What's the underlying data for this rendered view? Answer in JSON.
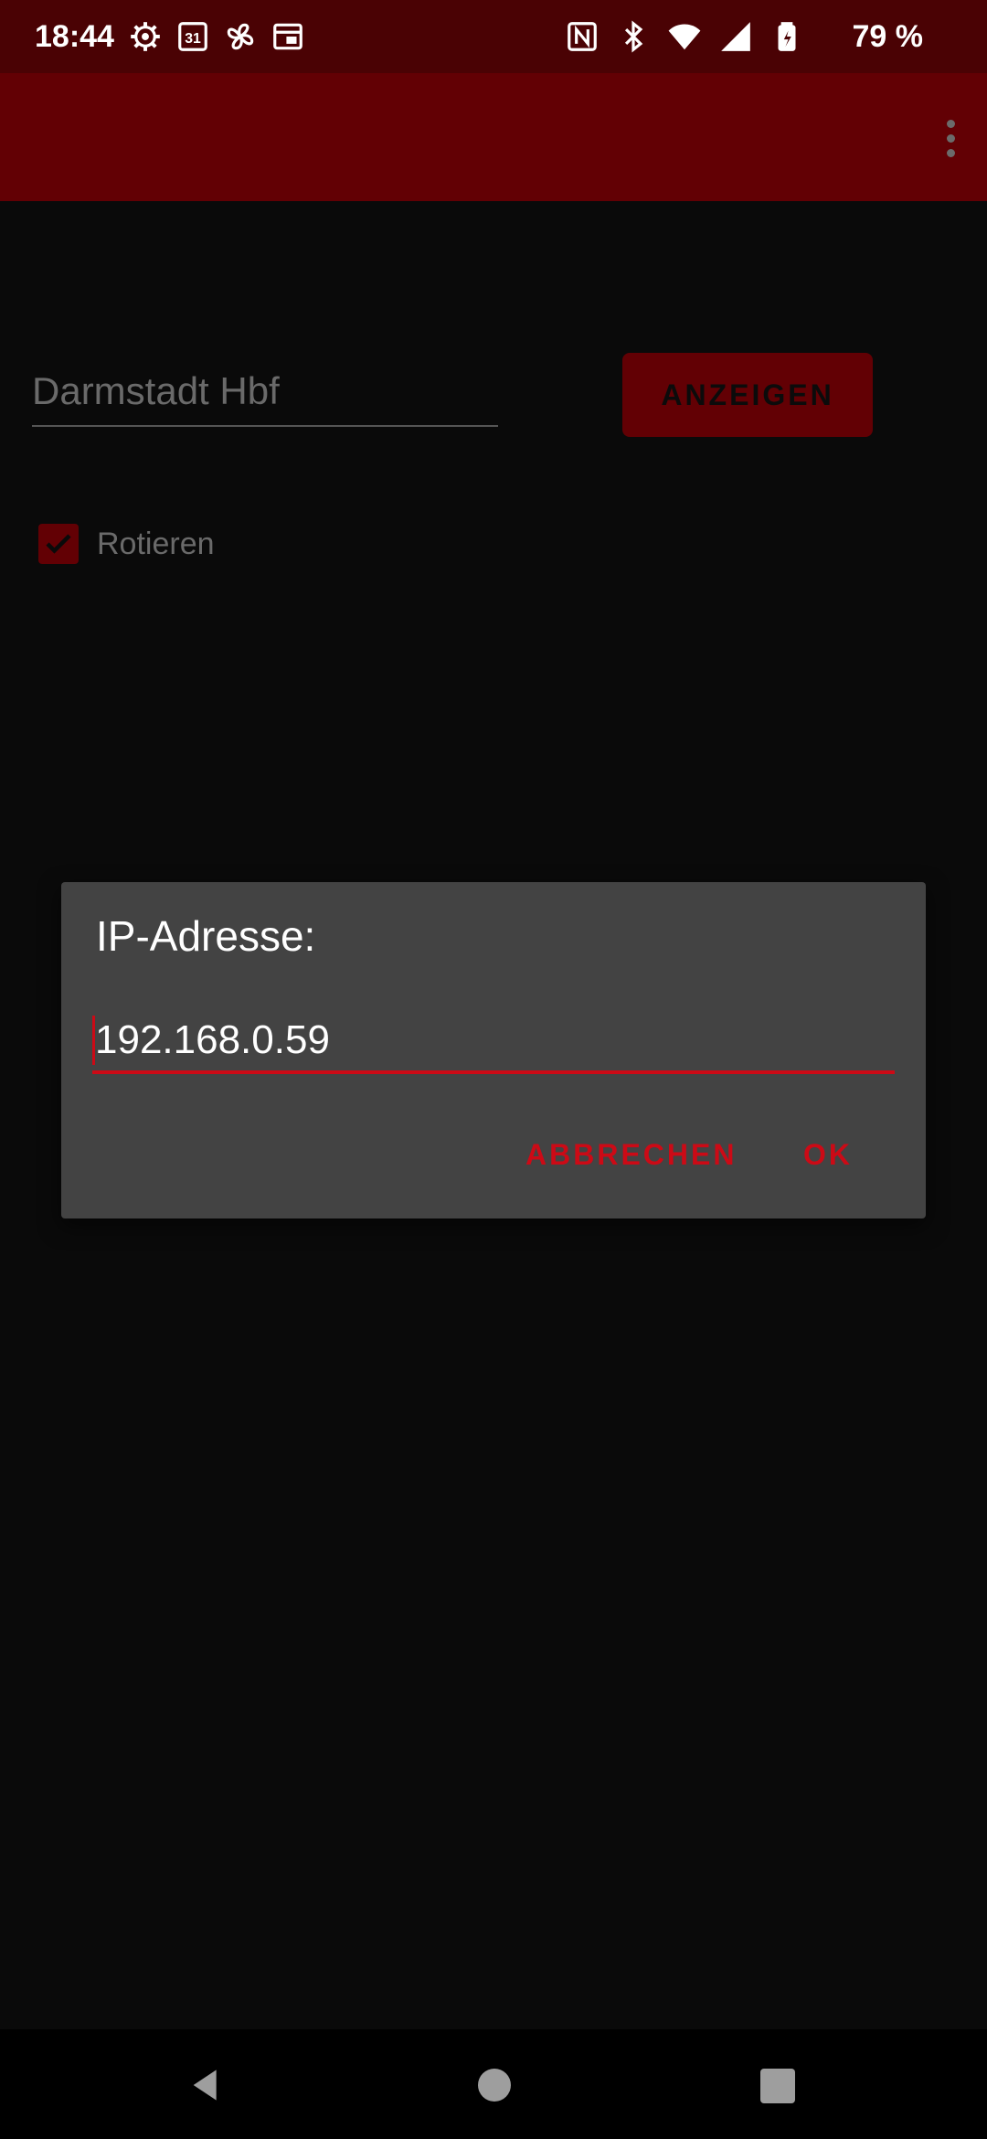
{
  "status_bar": {
    "time": "18:44",
    "left_icons": [
      "settings-gear-icon",
      "calendar-icon",
      "fan-icon",
      "browser-window-icon"
    ],
    "calendar_day": "31",
    "right_icons": [
      "nfc-icon",
      "bluetooth-icon",
      "wifi-icon",
      "cell-signal-icon",
      "battery-icon"
    ],
    "battery_percent": "79 %"
  },
  "app_bar": {
    "menu_icon": "more-vert-icon",
    "color": "#620004"
  },
  "main": {
    "station_input_value": "Darmstadt Hbf",
    "show_button_label": "ANZEIGEN",
    "rotate_checkbox": {
      "label": "Rotieren",
      "checked": true
    }
  },
  "dialog": {
    "title": "IP-Adresse:",
    "ip_value": "192.168.0.59",
    "cancel_label": "ABBRECHEN",
    "ok_label": "OK",
    "accent_color": "#cc0a16"
  },
  "nav_bar": {
    "icons": [
      "back-icon",
      "home-icon",
      "recents-icon"
    ]
  }
}
